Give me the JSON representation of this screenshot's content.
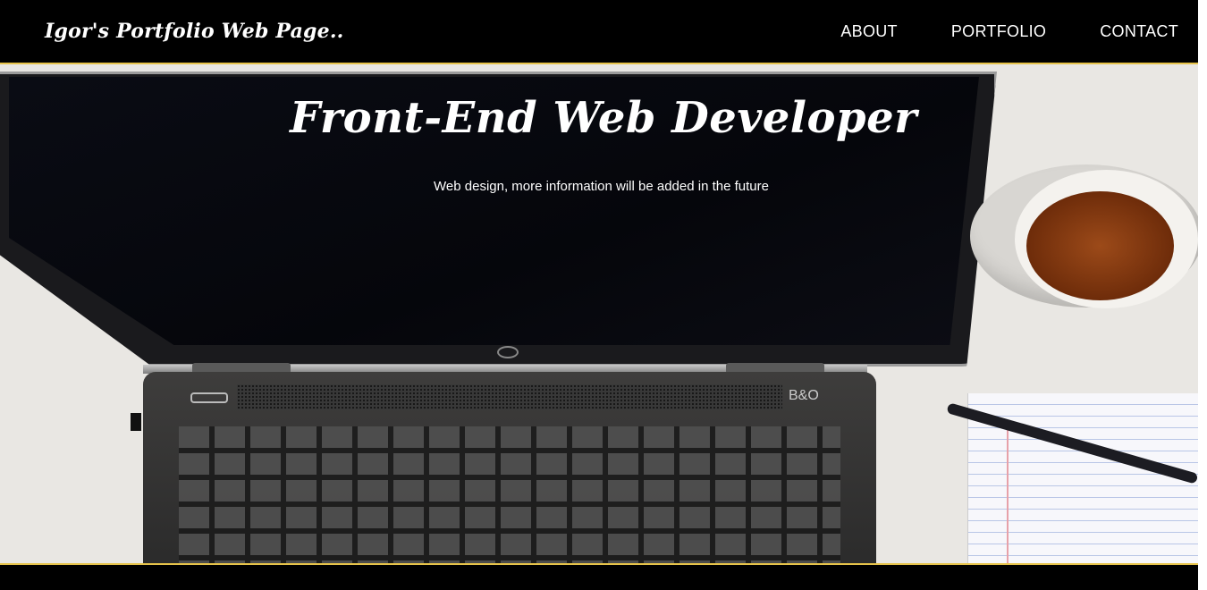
{
  "navbar": {
    "brand": "Igor's Portfolio Web Page..",
    "links": [
      {
        "label": "ABOUT"
      },
      {
        "label": "PORTFOLIO"
      },
      {
        "label": "CONTACT"
      }
    ]
  },
  "hero": {
    "title": "Front-End Web Developer",
    "subtitle": "Web design, more information will be added in the future",
    "laptop_logo_text": "B&O"
  },
  "colors": {
    "nav_background": "#000000",
    "accent_border": "#e6c34a",
    "text": "#ffffff"
  }
}
